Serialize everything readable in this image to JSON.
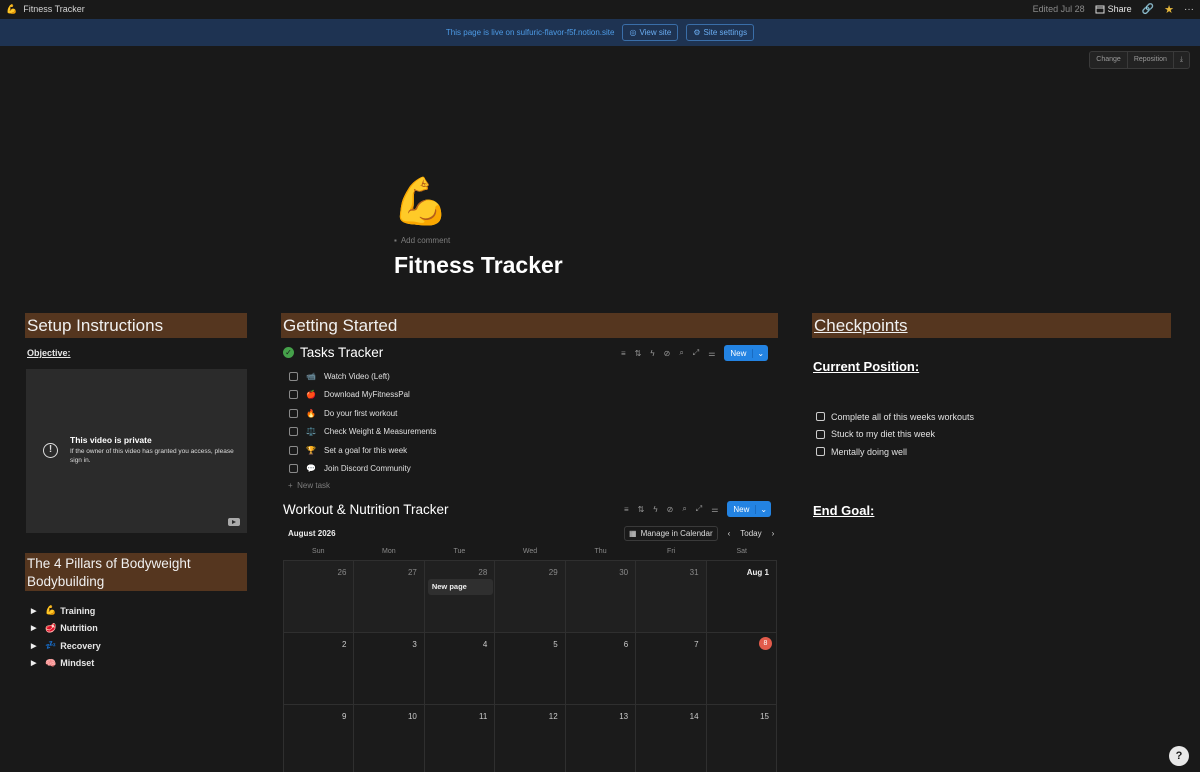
{
  "topbar": {
    "page_icon": "💪",
    "title": "Fitness Tracker",
    "edited": "Edited Jul 28",
    "share": "Share"
  },
  "banner": {
    "text": "This page is live on sulfuric-flavor-f5f.notion.site",
    "view_site": "View site",
    "site_settings": "Site settings"
  },
  "cover": {
    "change": "Change",
    "reposition": "Reposition"
  },
  "page": {
    "icon": "💪",
    "add_comment": "Add comment",
    "title": "Fitness Tracker"
  },
  "setup": {
    "heading": "Setup Instructions",
    "objective": "Objective:",
    "video_title": "This video is private",
    "video_desc": "If the owner of this video has granted you access, please sign in."
  },
  "pillars": {
    "heading": "The 4 Pillars of Bodyweight Bodybuilding",
    "items": [
      {
        "emoji": "💪",
        "label": "Training"
      },
      {
        "emoji": "🥩",
        "label": "Nutrition"
      },
      {
        "emoji": "💤",
        "label": "Recovery"
      },
      {
        "emoji": "🧠",
        "label": "Mindset"
      }
    ]
  },
  "getting_started": {
    "heading": "Getting Started",
    "tasks_title": "Tasks Tracker",
    "new_label": "New",
    "tasks": [
      {
        "emoji": "📹",
        "label": "Watch Video (Left)"
      },
      {
        "emoji": "🍎",
        "label": "Download MyFitnessPal"
      },
      {
        "emoji": "🔥",
        "label": "Do your first workout"
      },
      {
        "emoji": "⚖️",
        "label": "Check Weight & Measurements"
      },
      {
        "emoji": "🏆",
        "label": "Set a goal for this week"
      },
      {
        "emoji": "💬",
        "label": "Join Discord Community"
      }
    ],
    "new_task": "New task"
  },
  "calendar": {
    "title": "Workout & Nutrition Tracker",
    "new_label": "New",
    "month": "August 2026",
    "manage": "Manage in Calendar",
    "today": "Today",
    "weekdays": [
      "Sun",
      "Mon",
      "Tue",
      "Wed",
      "Thu",
      "Fri",
      "Sat"
    ],
    "days": [
      "26",
      "27",
      "28",
      "29",
      "30",
      "31",
      "Aug 1",
      "2",
      "3",
      "4",
      "5",
      "6",
      "7",
      "8",
      "9",
      "10",
      "11",
      "12",
      "13",
      "14",
      "15"
    ],
    "event": "New page"
  },
  "checkpoints": {
    "heading": "Checkpoints",
    "current": "Current Position:",
    "items": [
      "Complete all of this weeks workouts",
      "Stuck to my diet this week",
      "Mentally doing well"
    ],
    "end_goal": "End Goal:"
  },
  "colors": {
    "heading_bg": "#55361f",
    "accent": "#2383e2",
    "banner_bg": "#1e3352",
    "today": "#e25b4b"
  }
}
